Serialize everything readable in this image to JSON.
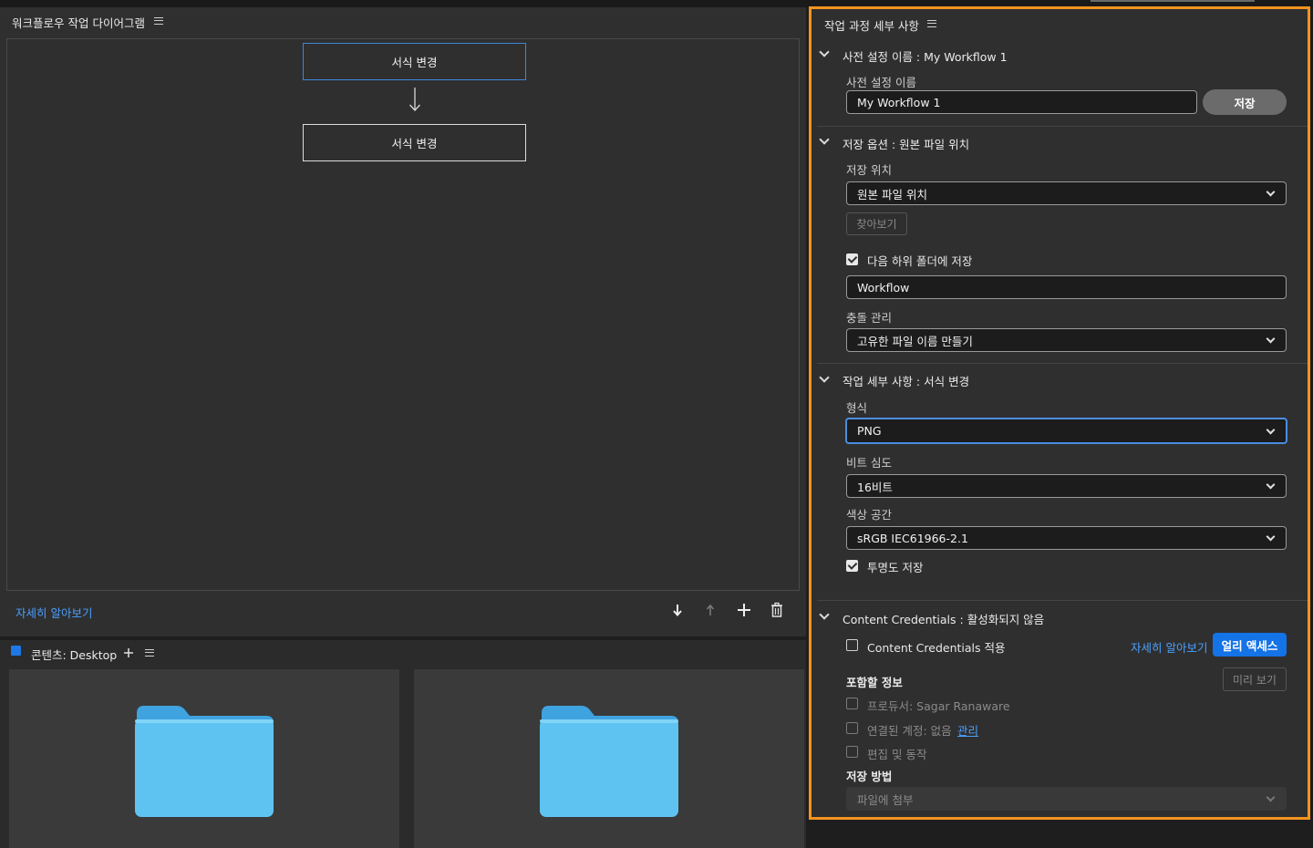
{
  "workflow_panel": {
    "title": "워크플로우 작업 다이어그램",
    "nodes": [
      "서식 변경",
      "서식 변경"
    ],
    "learn_more": "자세히 알아보기"
  },
  "content_panel": {
    "title": "콘텐츠: Desktop"
  },
  "details_panel": {
    "title": "작업 과정 세부 사항",
    "preset_section": {
      "header": "사전 설정 이름 : My Workflow 1",
      "label": "사전 설정 이름",
      "value": "My Workflow 1",
      "save_button": "저장"
    },
    "save_options": {
      "header": "저장 옵션 : 원본 파일 위치",
      "location_label": "저장 위치",
      "location_value": "원본 파일 위치",
      "browse_button": "찾아보기",
      "subfolder_label": "다음 하위 폴더에 저장",
      "subfolder_checked": true,
      "subfolder_value": "Workflow",
      "conflict_label": "충돌 관리",
      "conflict_value": "고유한 파일 이름 만들기"
    },
    "task_details": {
      "header": "작업 세부 사항 : 서식 변경",
      "format_label": "형식",
      "format_value": "PNG",
      "bitdepth_label": "비트 심도",
      "bitdepth_value": "16비트",
      "colorspace_label": "색상 공간",
      "colorspace_value": "sRGB IEC61966-2.1",
      "transparency_label": "투명도 저장",
      "transparency_checked": true
    },
    "credentials": {
      "header": "Content Credentials : 활성화되지 않음",
      "apply_label": "Content Credentials 적용",
      "learn_more": "자세히 알아보기",
      "early_access": "얼리 액세스",
      "include_label": "포함할 정보",
      "preview_button": "미리 보기",
      "producer": "프로듀서: Sagar Ranaware",
      "connected_accounts": "연결된 계정: 없음",
      "manage_link": "관리",
      "edits": "편집 및 동작",
      "save_method_label": "저장 방법",
      "save_method_value": "파일에 첨부"
    }
  },
  "colors": {
    "highlight_border": "#f5941e",
    "accent_blue": "#1473e6",
    "link_blue": "#4aa0ff",
    "folder_blue": "#5fc3f2"
  }
}
